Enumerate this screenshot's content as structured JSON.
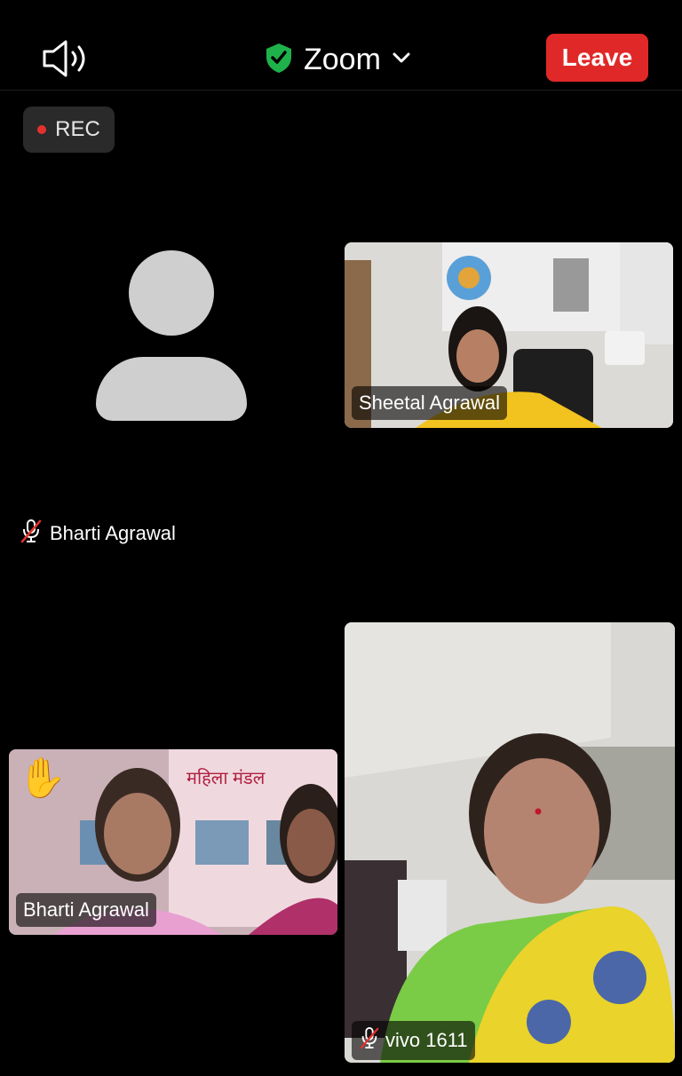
{
  "header": {
    "title": "Zoom",
    "leave_label": "Leave",
    "speaker_icon": "speaker-icon",
    "shield_icon": "shield-check-icon",
    "chevron_icon": "chevron-down-icon",
    "leave_color": "#e02828",
    "shield_color": "#1fb24a"
  },
  "recording": {
    "label": "REC",
    "dot_color": "#e3322e"
  },
  "participants": [
    {
      "name": "Bharti Agrawal",
      "muted": true,
      "video": false
    },
    {
      "name": "Sheetal Agrawal",
      "muted": false,
      "video": true
    },
    {
      "name": "Bharti Agrawal",
      "muted": false,
      "video": true,
      "hand_raised": true
    },
    {
      "name": "vivo 1611",
      "muted": true,
      "video": true
    }
  ],
  "scene": {
    "banner_text": "महिला मंडल"
  }
}
